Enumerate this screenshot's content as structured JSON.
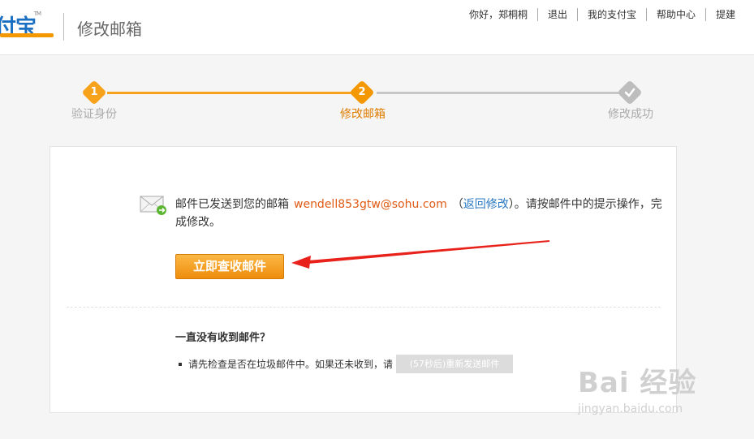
{
  "header": {
    "logo_text": "付宝",
    "logo_tm": "TM",
    "page_title": "修改邮箱",
    "nav": [
      "你好，郑桐桐",
      "退出",
      "我的支付宝",
      "帮助中心",
      "提建"
    ]
  },
  "steps": [
    {
      "num": "1",
      "label": "验证身份",
      "state": "done"
    },
    {
      "num": "2",
      "label": "修改邮箱",
      "state": "active"
    },
    {
      "num": "",
      "label": "修改成功",
      "state": "pending",
      "icon": "check-icon"
    }
  ],
  "colors": {
    "accent": "#f7a21b",
    "brand_blue": "#1a6fc2",
    "email": "#e05a14",
    "link": "#2a78c2",
    "annotation_arrow": "#e8221b"
  },
  "panel": {
    "message_prefix": "邮件已发送到您的邮箱",
    "email": "wendell853gtw@sohu.com",
    "paren_open": "（",
    "change_link": "返回修改",
    "paren_close": "）",
    "message_suffix": "。请按邮件中的提示操作，完成修改。",
    "check_button": "立即查收邮件",
    "question": "一直没有收到邮件？",
    "tip": "请先检查是否在垃圾邮件中。如果还未收到，请",
    "resend_button": "(57秒后)重新发送邮件"
  },
  "watermark": {
    "brand": "Bai 经验",
    "url": "jingyan.baidu.com"
  }
}
